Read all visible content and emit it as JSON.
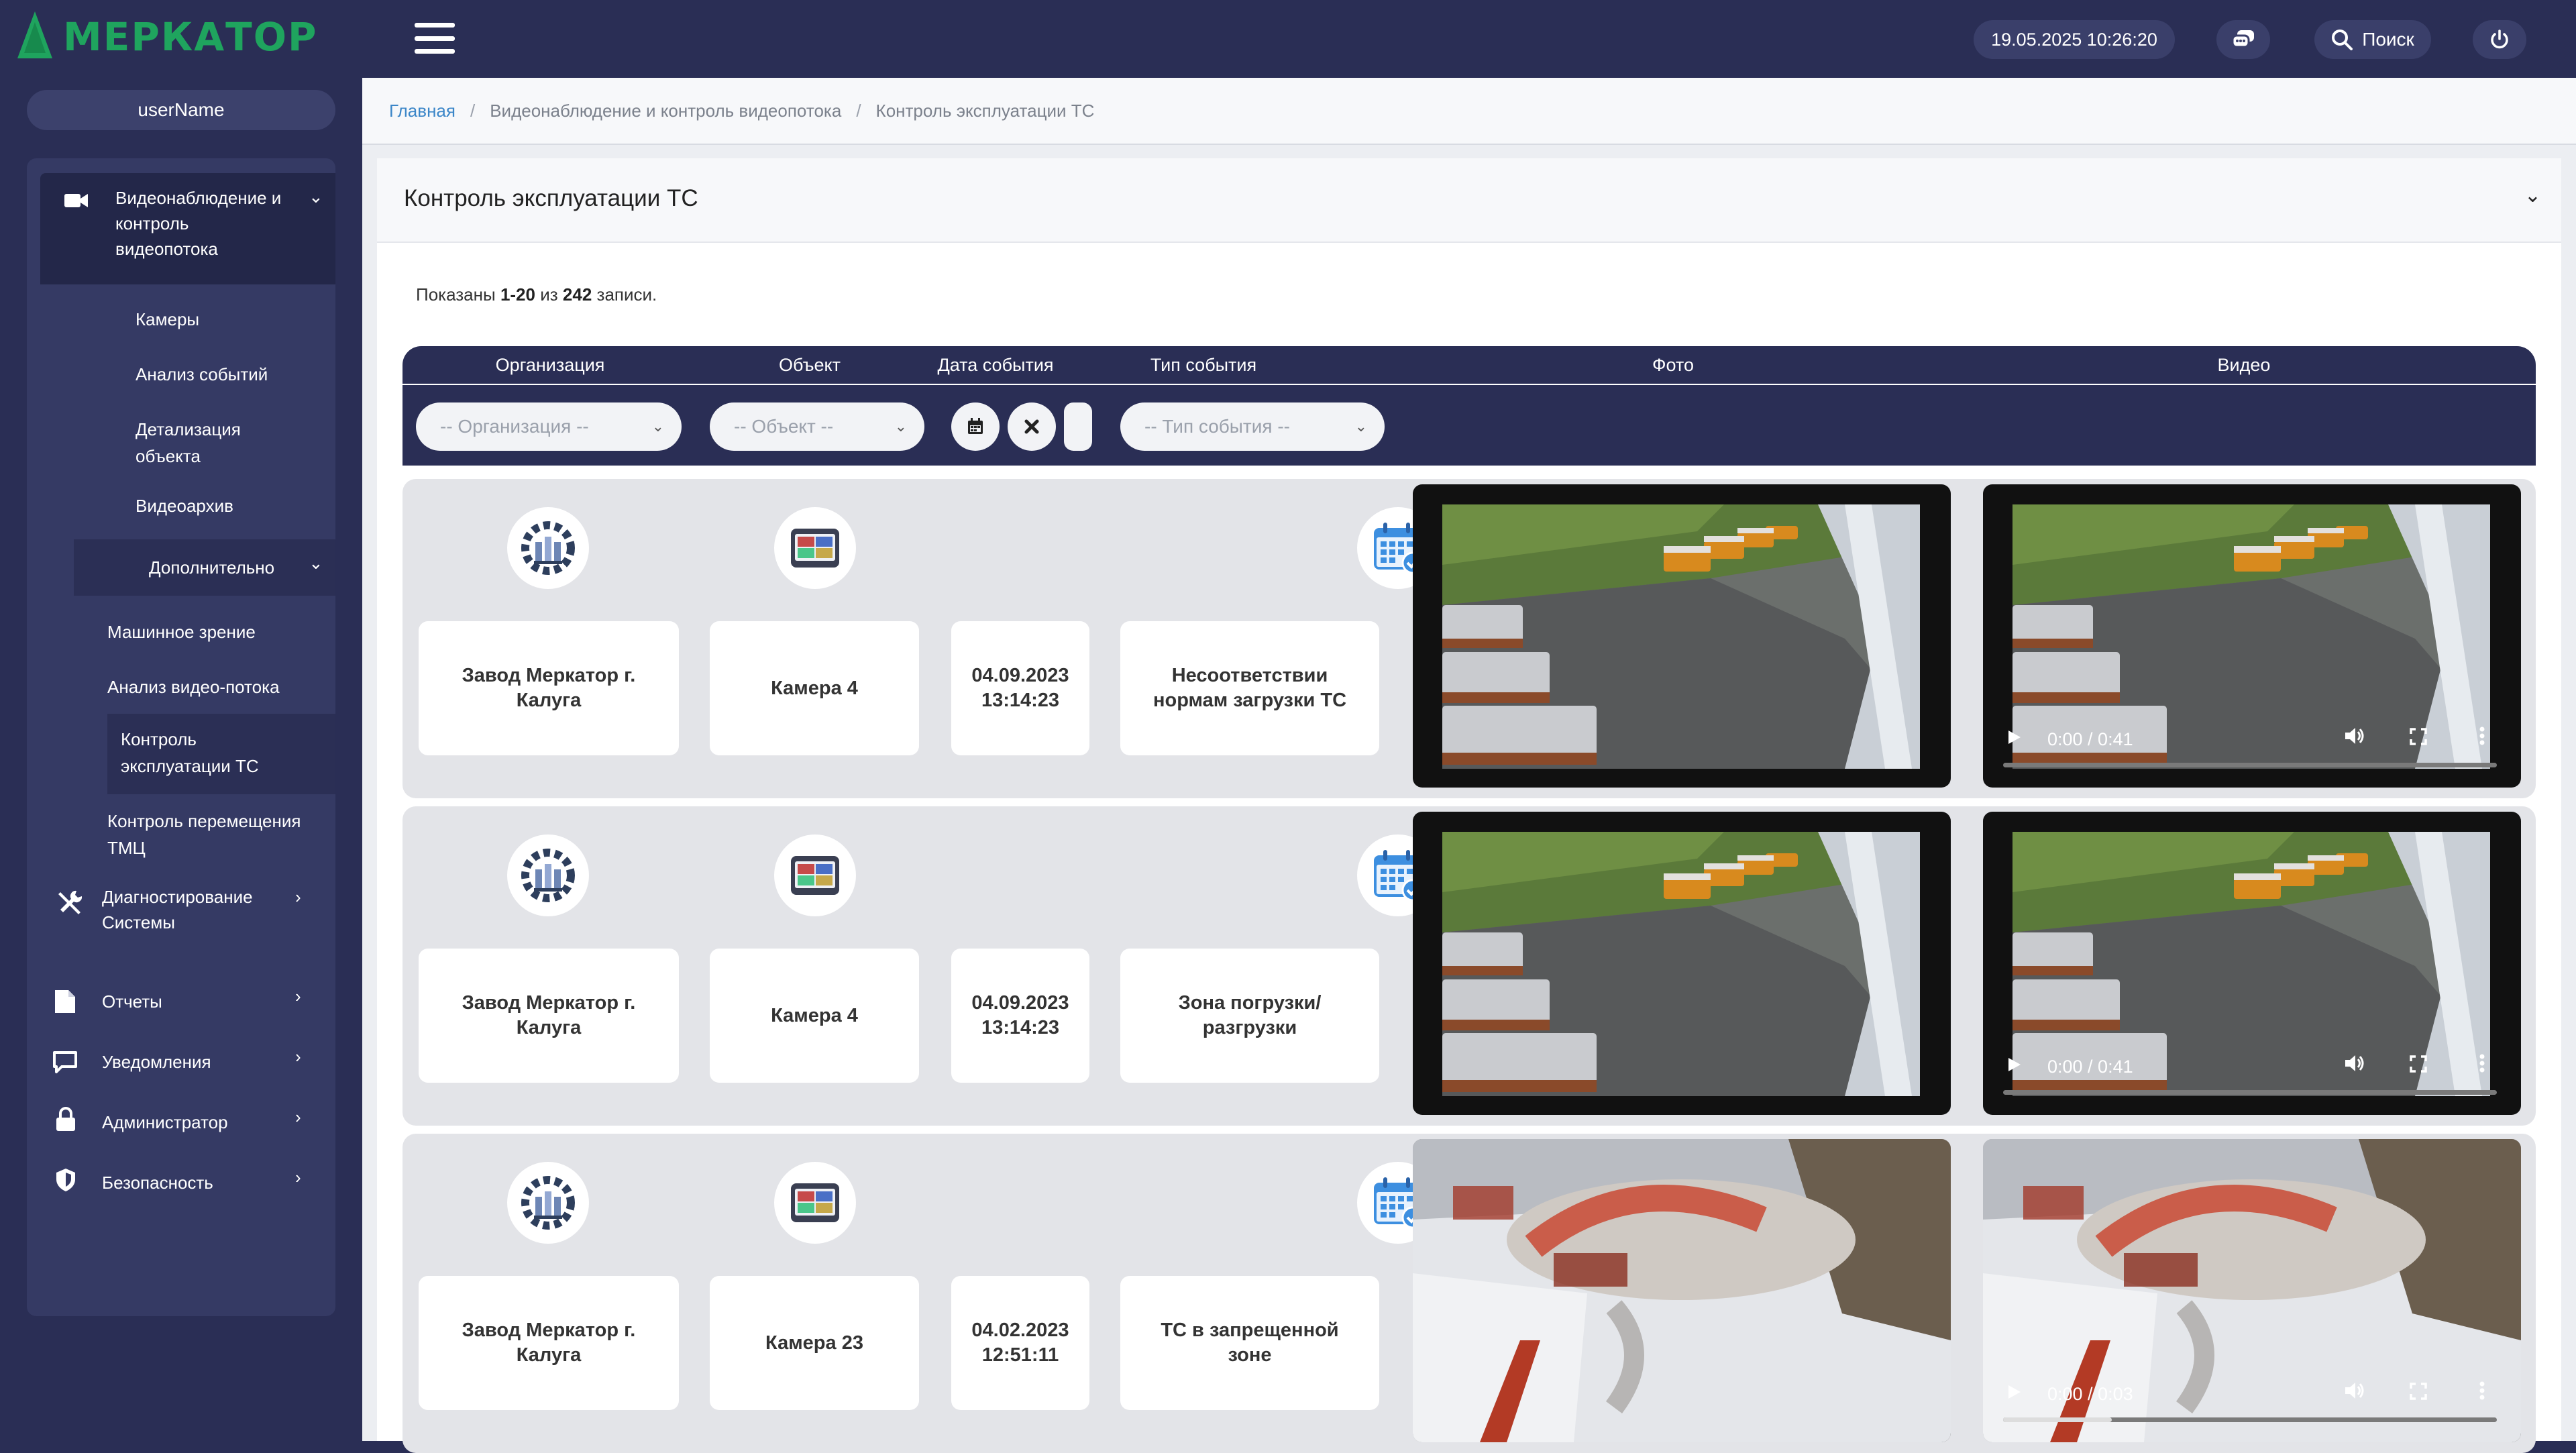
{
  "header": {
    "logo_text": "МЕРКАТОР",
    "datetime": "19.05.2025 10:26:20",
    "search_label": "Поиск",
    "colors": {
      "bar": "#2a2e55",
      "brand": "#1fa45e",
      "accent": "#3b86c8"
    }
  },
  "sidebar": {
    "username": "userName",
    "group_video": {
      "label": "Видеонаблюдение и контроль видеопотока",
      "icon": "video-camera-icon"
    },
    "video_items": [
      {
        "label": "Камеры"
      },
      {
        "label": "Анализ событий"
      },
      {
        "label": "Детализация объекта"
      },
      {
        "label": "Видеоархив"
      }
    ],
    "extra": {
      "label": "Дополнительно"
    },
    "extra_items": [
      {
        "label": "Машинное зрение"
      },
      {
        "label": "Анализ видео-потока"
      },
      {
        "label": "Контроль эксплуатации ТС"
      },
      {
        "label": "Контроль перемещения ТМЦ"
      }
    ],
    "sections": [
      {
        "label": "Диагностирование Системы",
        "icon": "tools-icon"
      },
      {
        "label": "Отчеты",
        "icon": "document-icon"
      },
      {
        "label": "Уведомления",
        "icon": "message-icon"
      },
      {
        "label": "Администратор",
        "icon": "lock-icon"
      },
      {
        "label": "Безопасность",
        "icon": "shield-icon"
      }
    ]
  },
  "breadcrumb": {
    "home": "Главная",
    "section": "Видеонаблюдение и контроль видеопотока",
    "current": "Контроль эксплуатации ТС",
    "separator": "/"
  },
  "card": {
    "title": "Контроль эксплуатации ТС",
    "summary_prefix": "Показаны",
    "summary_range": "1-20",
    "summary_mid": "из",
    "summary_total": "242",
    "summary_suffix": "записи."
  },
  "table": {
    "columns": [
      "Организация",
      "Объект",
      "Дата события",
      "Тип события",
      "Фото",
      "Видео"
    ],
    "filters": {
      "organization_placeholder": "-- Организация --",
      "object_placeholder": "-- Объект --",
      "event_type_placeholder": "-- Тип события --"
    },
    "rows": [
      {
        "organization": "Завод Меркатор г. Калуга",
        "object": "Камера 4",
        "date": "04.09.2023 13:14:23",
        "event_type": "Несоответствии нормам загрузки ТС",
        "event_icon": "truck-warning-icon",
        "video_time": "0:00 / 0:41",
        "video_progress": 0.0,
        "scene": "yard"
      },
      {
        "organization": "Завод Меркатор г. Калуга",
        "object": "Камера 4",
        "date": "04.09.2023 13:14:23",
        "event_type": "Зона погрузки/ разгрузки",
        "event_icon": "loading-zone-icon",
        "video_time": "0:00 / 0:41",
        "video_progress": 0.0,
        "scene": "yard"
      },
      {
        "organization": "Завод Меркатор г. Калуга",
        "object": "Камера 23",
        "date": "04.02.2023 12:51:11",
        "event_type": "ТС в запрещенной зоне",
        "event_icon": "restricted-zone-icon",
        "video_time": "0:00 / 0:03",
        "video_progress": 0.22,
        "scene": "snow"
      }
    ]
  }
}
